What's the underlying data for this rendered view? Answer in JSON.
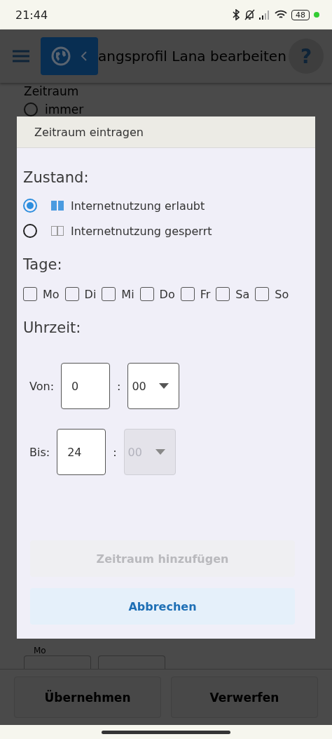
{
  "status_bar": {
    "time": "21:44",
    "battery": "48"
  },
  "header": {
    "title": "angsprofil Lana bearbeiten",
    "help": "?"
  },
  "background": {
    "section_label": "Zeitraum",
    "option": {
      "label": "immer",
      "selected": false
    },
    "fields": [
      {
        "kind": "labeled",
        "legend": "Mo"
      },
      {
        "kind": "plain"
      }
    ]
  },
  "footer": {
    "buttons": [
      {
        "label": "Übernehmen"
      },
      {
        "label": "Verwerfen"
      }
    ]
  },
  "dialog": {
    "title": "Zeitraum eintragen",
    "state_heading": "Zustand:",
    "states": [
      {
        "label": "Internetnutzung erlaubt",
        "selected": true,
        "kind": "allowed"
      },
      {
        "label": "Internetnutzung gesperrt",
        "selected": false,
        "kind": "blocked"
      }
    ],
    "days_heading": "Tage:",
    "days": [
      {
        "label": "Mo",
        "checked": false
      },
      {
        "label": "Di",
        "checked": false
      },
      {
        "label": "Mi",
        "checked": false
      },
      {
        "label": "Do",
        "checked": false
      },
      {
        "label": "Fr",
        "checked": false
      },
      {
        "label": "Sa",
        "checked": false
      },
      {
        "label": "So",
        "checked": false
      }
    ],
    "time_heading": "Uhrzeit:",
    "times": [
      {
        "label": "Von:",
        "hour": "0",
        "separator": ":",
        "minute": "00",
        "disabled": false
      },
      {
        "label": "Bis:",
        "hour": "24",
        "separator": ":",
        "minute": "00",
        "disabled": true
      }
    ],
    "add_button": {
      "label": "Zeitraum hinzufügen",
      "disabled": true
    },
    "cancel_button": {
      "label": "Abbrechen"
    }
  }
}
